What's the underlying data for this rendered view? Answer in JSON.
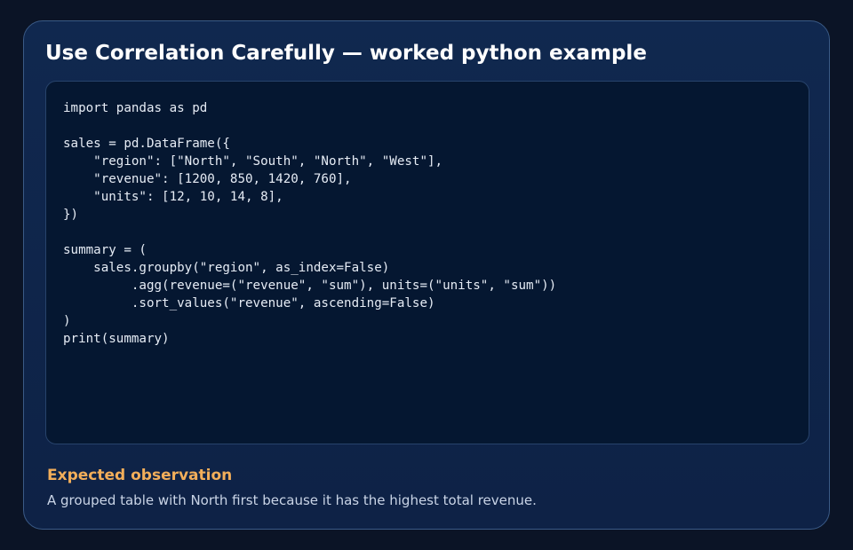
{
  "title": "Use Correlation Carefully — worked python example",
  "code": {
    "language": "python",
    "lines": [
      "import pandas as pd",
      "",
      "sales = pd.DataFrame({",
      "    \"region\": [\"North\", \"South\", \"North\", \"West\"],",
      "    \"revenue\": [1200, 850, 1420, 760],",
      "    \"units\": [12, 10, 14, 8],",
      "})",
      "",
      "summary = (",
      "    sales.groupby(\"region\", as_index=False)",
      "         .agg(revenue=(\"revenue\", \"sum\"), units=(\"units\", \"sum\"))",
      "         .sort_values(\"revenue\", ascending=False)",
      ")",
      "print(summary)"
    ]
  },
  "observation": {
    "heading": "Expected observation",
    "text": "A grouped table with North first because it has the highest total revenue."
  },
  "colors": {
    "page_background": "#0b1426",
    "card_background": "#10284f",
    "card_border": "#3a5a86",
    "code_background": "#051731",
    "title_text": "#ffffff",
    "code_text": "#e6ecf5",
    "accent_heading": "#f2ae5a",
    "body_text": "#c9d4e6"
  }
}
